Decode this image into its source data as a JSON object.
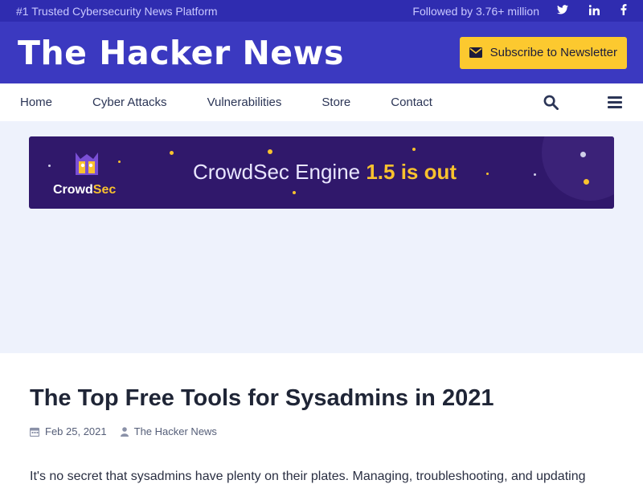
{
  "topbar": {
    "tagline": "#1 Trusted Cybersecurity News Platform",
    "followed": "Followed by 3.76+ million",
    "social": [
      "twitter-icon",
      "linkedin-icon",
      "facebook-icon"
    ]
  },
  "header": {
    "logo": "The Hacker News",
    "subscribe_label": "Subscribe to Newsletter"
  },
  "nav": {
    "items": [
      "Home",
      "Cyber Attacks",
      "Vulnerabilities",
      "Store",
      "Contact"
    ],
    "icons": [
      "search-icon",
      "menu-icon"
    ]
  },
  "ad": {
    "brand_a": "Crowd",
    "brand_b": "Sec",
    "headline_a": "CrowdSec Engine ",
    "headline_b": "1.5 is out"
  },
  "article": {
    "title": "The Top Free Tools for Sysadmins in 2021",
    "date": "Feb 25, 2021",
    "author": "The Hacker News",
    "excerpt": "It's no secret that sysadmins have plenty on their plates. Managing, troubleshooting, and updating"
  },
  "colors": {
    "topbar_bg": "#2f2cb0",
    "header_bg": "#3b39c0",
    "accent": "#fcc92f",
    "ad_bg": "#30186b"
  }
}
